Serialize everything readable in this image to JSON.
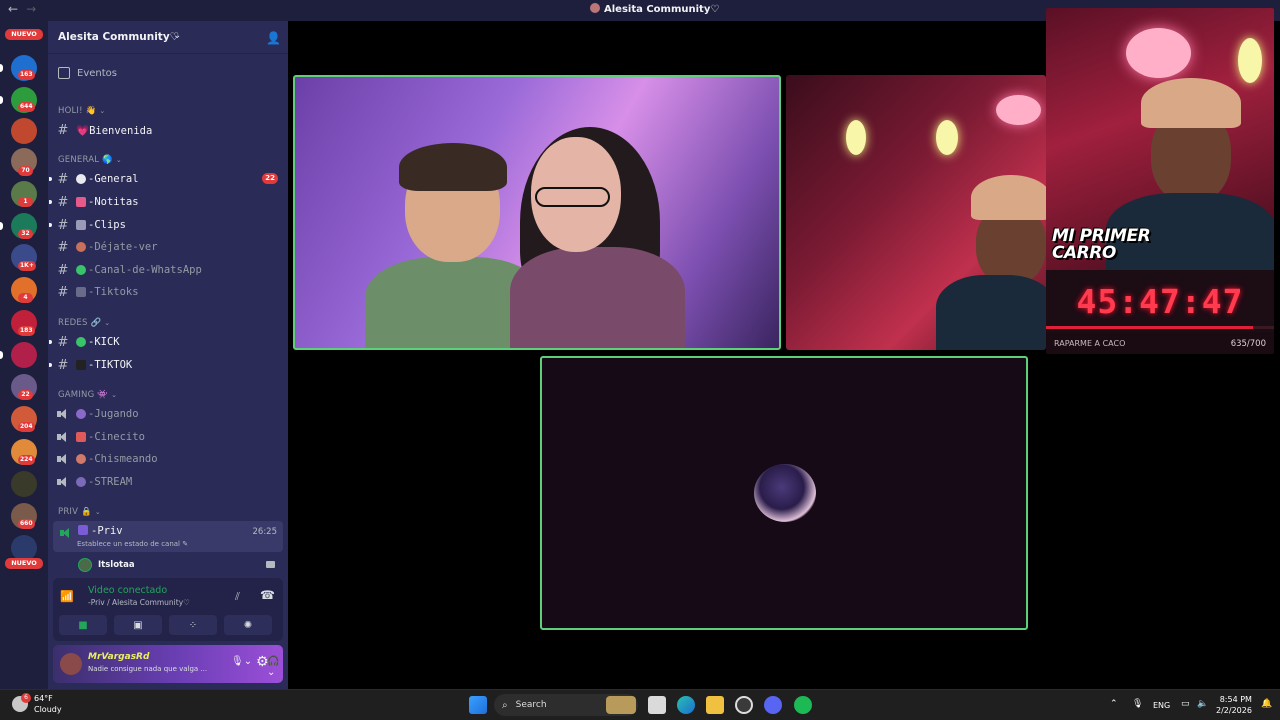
{
  "window": {
    "title": "Alesita Community♡"
  },
  "rail": {
    "nuevo_top": "NUEVO",
    "nuevo_bottom": "NUEVO",
    "badges": [
      "163",
      "644",
      "70",
      "1",
      "32",
      "1K+",
      "4",
      "183",
      "22",
      "204",
      "224",
      "660"
    ]
  },
  "sidebar": {
    "guild_name": "Alesita Community♡",
    "events_label": "Eventos",
    "categories": {
      "holi": "HOLI! 👋",
      "general": "GENERAL 🌎",
      "redes": "REDES 🔗",
      "gaming": "GAMING 👾",
      "priv": "PRIV 🔒"
    },
    "channels": {
      "bienvenida": "💗Bienvenida",
      "general": "-General",
      "general_count": "22",
      "notitas": "-Notitas",
      "clips": "-Clips",
      "dejate_ver": "-Déjate-ver",
      "whatsapp": "-Canal-de-WhatsApp",
      "tiktoks": "-Tiktoks",
      "kick": "-KICK",
      "tiktok": "-TIKTOK",
      "jugando": "-Jugando",
      "cinecito": "-Cinecito",
      "chismeando": "-Chismeando",
      "stream": "-STREAM",
      "priv": "-Priv",
      "priv_time": "26:25",
      "priv_status": "Establece un estado de canal ✎",
      "member": "Itslotaa"
    }
  },
  "voice": {
    "title": "Video conectado",
    "subtitle": "-Priv / Alesita Community♡"
  },
  "user": {
    "name": "MrVargasRd",
    "status": "Nadie consigue nada que valga ..."
  },
  "overlay": {
    "banner_line1": "MI PRIMER",
    "banner_line2": "CARRO",
    "timer": "45:47:47",
    "goal_label": "RAPARME A CACO",
    "goal_count": "635/700",
    "goal_progress": 0.907
  },
  "taskbar": {
    "temp": "64°F",
    "condition": "Cloudy",
    "weather_badge": "6",
    "search_label": "Search",
    "lang": "ENG",
    "time": "8:54 PM",
    "date": "2/2/2026"
  },
  "colors": {
    "sidebar_bg": "#2b2b57",
    "rail_bg": "#1e1f3c",
    "speaking_border": "#5fd07a",
    "mention_badge": "#e03a3a",
    "voice_connected": "#23a55a",
    "timer_red": "#ff3b4d"
  }
}
